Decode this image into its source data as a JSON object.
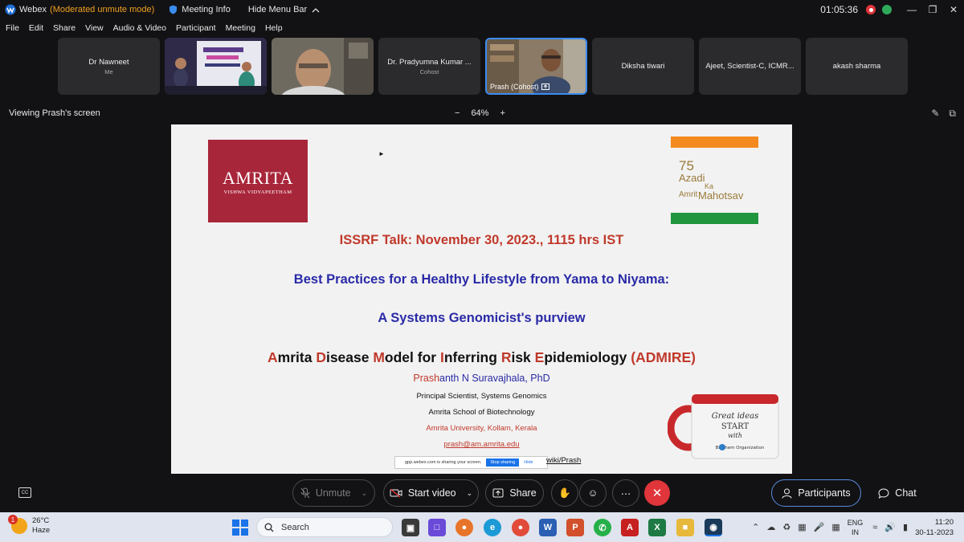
{
  "titlebar": {
    "app_name": "Webex",
    "mode": "(Moderated unmute mode)",
    "meeting_info": "Meeting Info",
    "hide_menu": "Hide Menu Bar",
    "clock": "01:05:36"
  },
  "menu": [
    "File",
    "Edit",
    "Share",
    "View",
    "Audio & Video",
    "Participant",
    "Meeting",
    "Help"
  ],
  "participants": [
    {
      "name": "Dr Nawneet",
      "sub": "Me"
    },
    {
      "name": "",
      "sub": ""
    },
    {
      "name": "",
      "sub": ""
    },
    {
      "name": "Dr. Pradyumna Kumar ...",
      "sub": "Cohost"
    },
    {
      "name": "Prash (Cohost)",
      "sub": ""
    },
    {
      "name": "Diksha tiwari",
      "sub": ""
    },
    {
      "name": "Ajeet, Scientist-C, ICMR...",
      "sub": ""
    },
    {
      "name": "akash sharma",
      "sub": ""
    }
  ],
  "viewbar": {
    "label": "Viewing Prash's screen",
    "zoom": "64%"
  },
  "slide": {
    "logo_amrita": "AMRITA",
    "logo_amrita_sub": "VISHWA VIDYAPEETHAM",
    "azadi_text_1": "Azadi",
    "azadi_text_2": "Ka",
    "azadi_text_3": "Amrit",
    "azadi_text_4": "Mahotsav",
    "azadi_num": "75",
    "talk": "ISSRF Talk: November 30, 2023., 1115 hrs IST",
    "best": "Best Practices for a Healthy Lifestyle from Yama to Niyama:",
    "systems": "A Systems Genomicist's purview",
    "admire": {
      "a1": "A",
      "a1r": "mrita ",
      "d1": "D",
      "d1r": "isease ",
      "m1": "M",
      "m1r": "odel for ",
      "i1": "I",
      "i1r": "nferring ",
      "r1": "R",
      "r1r": "isk ",
      "e1": "E",
      "e1r": "pidemiology ",
      "tag": "(ADMIRE)"
    },
    "name_red": "Prash",
    "name_blue": "anth N Suravajhala, PhD",
    "role": "Principal Scientist,  Systems Genomics",
    "school": "Amrita School of Biotechnology",
    "univ": "Amrita University, Kollam, Kerala",
    "email": "prash@am.amrita.edu",
    "wiki": "wiki/Prash",
    "share_notice": "gpp.webex.com is sharing your screen.",
    "stop_sharing": "Stop sharing",
    "hide": "Hide",
    "mug_text_1": "Great ideas",
    "mug_text_2": "START",
    "mug_text_3": "with",
    "mug_text_4": "Biochem Organization"
  },
  "controls": {
    "unmute": "Unmute",
    "start_video": "Start video",
    "share": "Share",
    "participants": "Participants",
    "chat": "Chat"
  },
  "taskbar": {
    "weather_temp": "26°C",
    "weather_desc": "Haze",
    "weather_badge": "1",
    "search": "Search",
    "lang_1": "ENG",
    "lang_2": "IN",
    "time": "11:20",
    "date": "30-11-2023"
  }
}
